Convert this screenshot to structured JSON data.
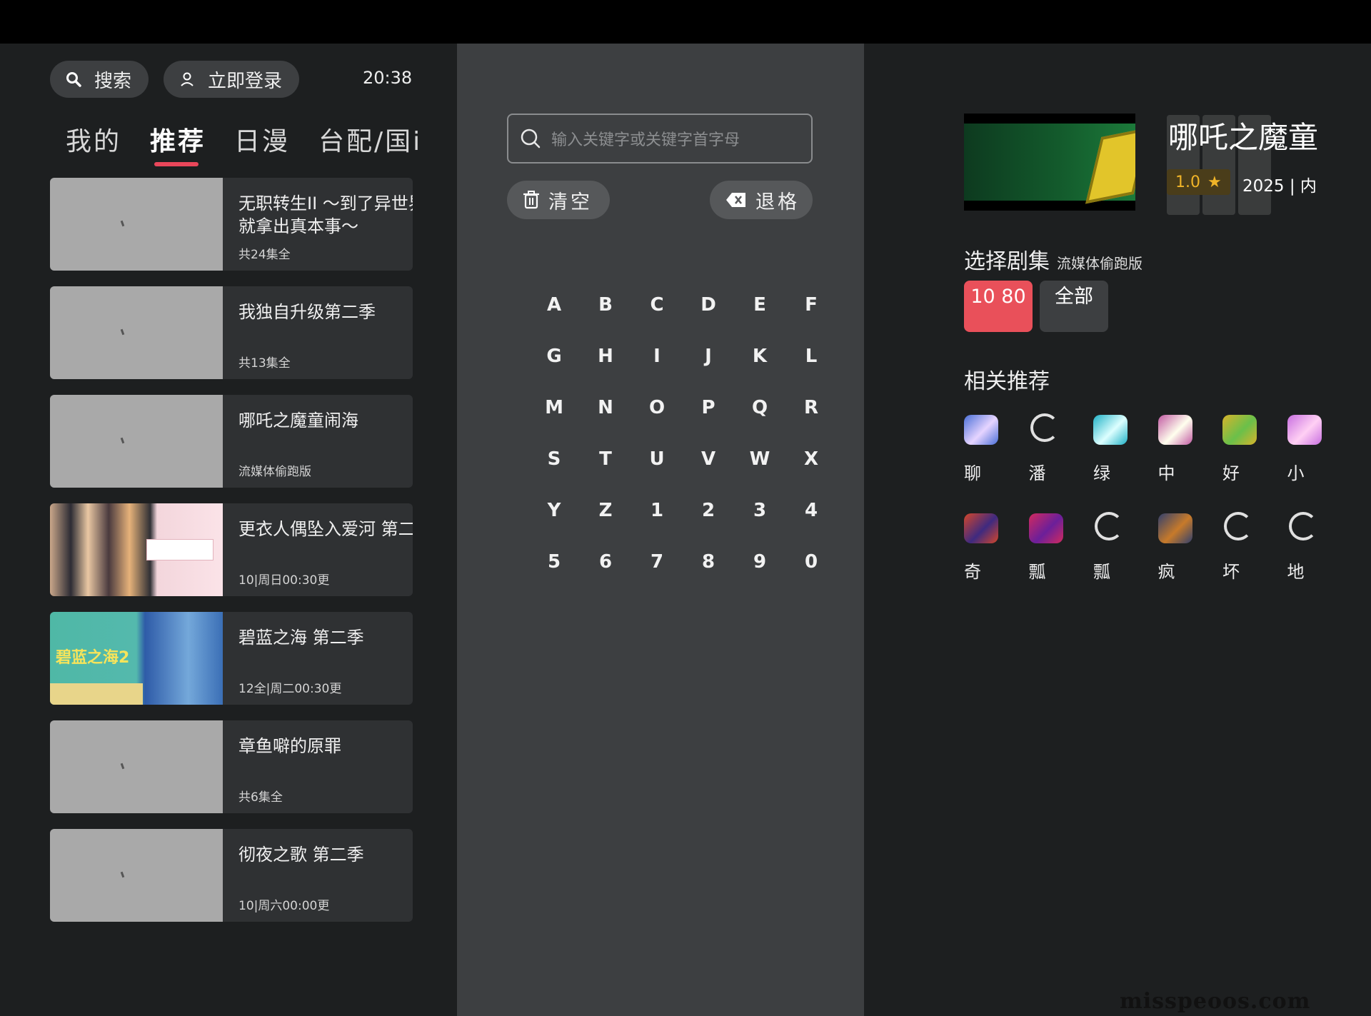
{
  "header": {
    "search_label": "搜索",
    "login_label": "立即登录",
    "time": "20:38",
    "tabs": [
      {
        "label": "我的"
      },
      {
        "label": "推荐"
      },
      {
        "label": "日漫"
      },
      {
        "label": "台配/国i"
      }
    ]
  },
  "list": [
    {
      "title": "无职转生II ～到了异世界就拿出真本事～",
      "sub": "共24集全"
    },
    {
      "title": "我独自升级第二季",
      "sub": "共13集全"
    },
    {
      "title": "哪吒之魔童闹海",
      "sub": "流媒体偷跑版"
    },
    {
      "title": "更衣人偶坠入爱河 第二",
      "sub": "10|周日00:30更"
    },
    {
      "title": "碧蓝之海 第二季",
      "sub": "12全|周二00:30更"
    },
    {
      "title": "章鱼噼的原罪",
      "sub": "共6集全"
    },
    {
      "title": "彻夜之歌 第二季",
      "sub": "10|周六00:00更"
    }
  ],
  "search": {
    "placeholder": "输入关键字或关键字首字母",
    "clear_label": "清空",
    "backspace_label": "退格",
    "keys": [
      "A",
      "B",
      "C",
      "D",
      "E",
      "F",
      "G",
      "H",
      "I",
      "J",
      "K",
      "L",
      "M",
      "N",
      "O",
      "P",
      "Q",
      "R",
      "S",
      "T",
      "U",
      "V",
      "W",
      "X",
      "Y",
      "Z",
      "1",
      "2",
      "3",
      "4",
      "5",
      "6",
      "7",
      "8",
      "9",
      "0"
    ]
  },
  "detail": {
    "title": "哪吒之魔童",
    "rating": "1.0",
    "year": "2025 | 内",
    "episodes_title": "选择剧集",
    "episodes_source": "流媒体偷跑版",
    "episode_active": "10 80",
    "episode_all": "全部",
    "related_title": "相关推荐",
    "related": [
      {
        "label": "聊",
        "icon": "game-icon"
      },
      {
        "label": "潘",
        "icon": "loading-icon"
      },
      {
        "label": "绿",
        "icon": "game-icon"
      },
      {
        "label": "中",
        "icon": "game-icon"
      },
      {
        "label": "好",
        "icon": "game-icon"
      },
      {
        "label": "小",
        "icon": "game-icon"
      },
      {
        "label": "奇",
        "icon": "game-icon"
      },
      {
        "label": "瓢",
        "icon": "game-icon"
      },
      {
        "label": "瓢",
        "icon": "loading-icon"
      },
      {
        "label": "疯",
        "icon": "game-icon"
      },
      {
        "label": "坏",
        "icon": "loading-icon"
      },
      {
        "label": "地",
        "icon": "loading-icon"
      }
    ]
  },
  "watermark": "misspeoos.com",
  "colors": {
    "accent": "#e9465a",
    "rating": "#f0b428",
    "panel": "#3d3f41",
    "bg": "#1d1f20"
  }
}
